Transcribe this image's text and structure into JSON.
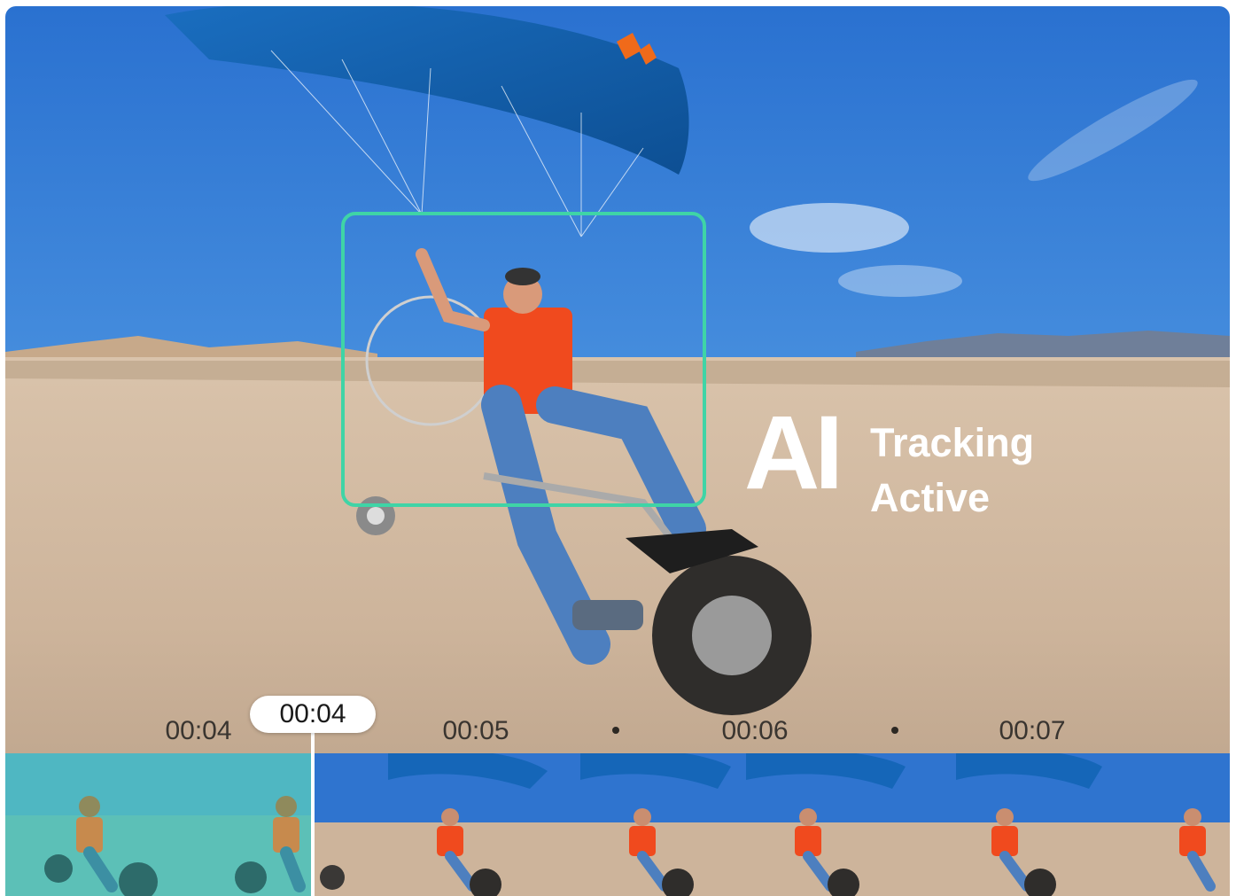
{
  "overlay": {
    "ai_big": "AI",
    "ai_line1": "Tracking",
    "ai_line2": "Active"
  },
  "timeline": {
    "playhead_time": "00:04",
    "labels": [
      "00:04",
      "00:05",
      "00:06",
      "00:07"
    ],
    "highlight_color": "#3fd4a6"
  }
}
